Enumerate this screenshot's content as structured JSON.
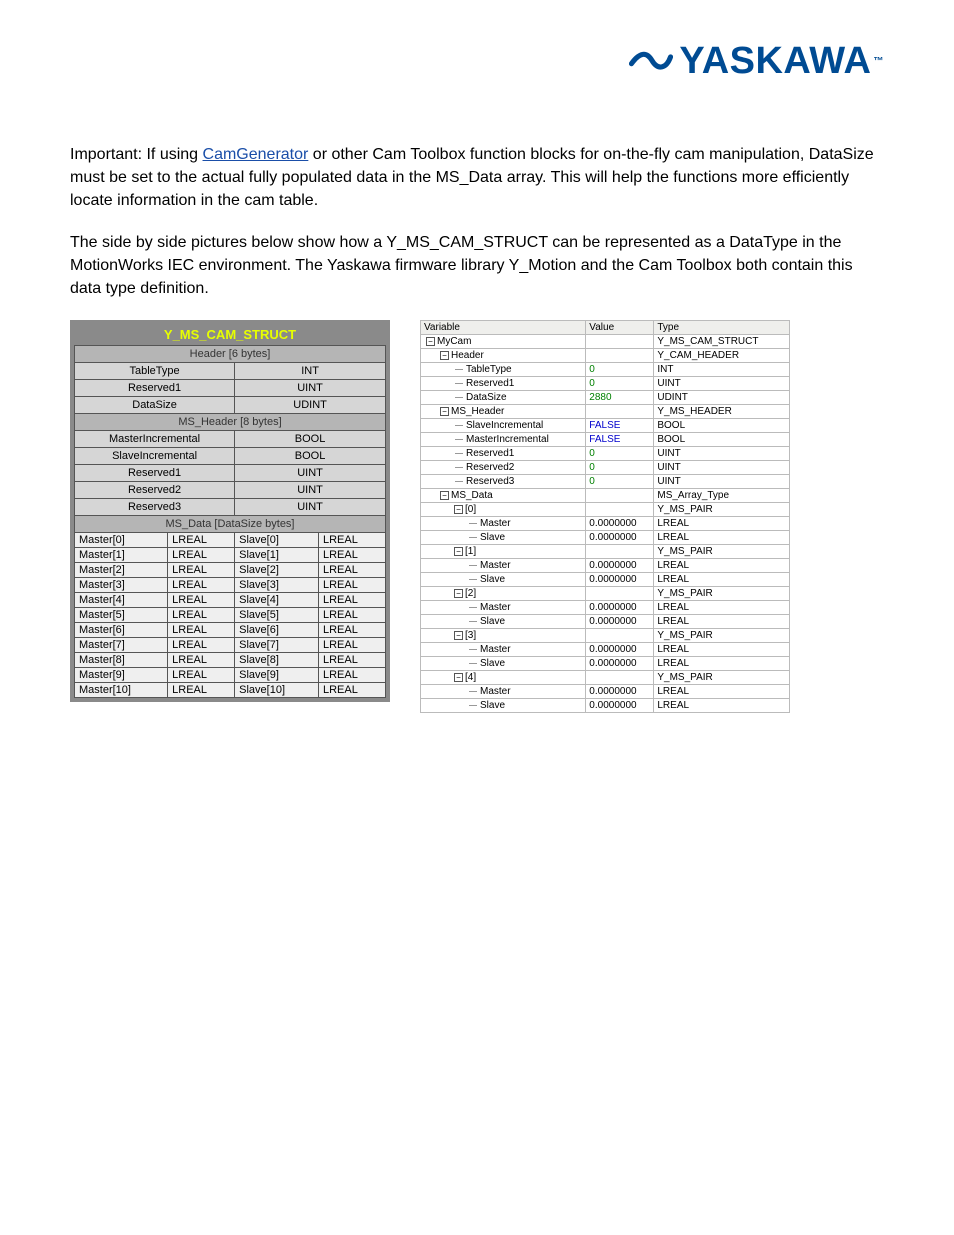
{
  "logo": {
    "text": "YASKAWA",
    "tm": "™"
  },
  "paragraphs": {
    "p1_a": "Important: If using ",
    "p1_link": "CamGenerator",
    "p1_b": " or other Cam Toolbox function blocks for on-the-fly cam manipulation, DataSize must be set to the actual fully populated data in the MS_Data array. This will help the functions more efficiently locate information in the cam table.",
    "p2": "The side by side pictures below show how a Y_MS_CAM_STRUCT can be represented as a DataType in the MotionWorks IEC environment. The Yaskawa firmware library Y_Motion and the Cam Toolbox both contain this data type definition."
  },
  "struct": {
    "title": "Y_MS_CAM_STRUCT",
    "header_label": "Header [6 bytes]",
    "header_rows": [
      {
        "n": "TableType",
        "t": "INT"
      },
      {
        "n": "Reserved1",
        "t": "UINT"
      },
      {
        "n": "DataSize",
        "t": "UDINT"
      }
    ],
    "msheader_label": "MS_Header [8 bytes]",
    "msheader_rows": [
      {
        "n": "MasterIncremental",
        "t": "BOOL"
      },
      {
        "n": "SlaveIncremental",
        "t": "BOOL"
      },
      {
        "n": "Reserved1",
        "t": "UINT"
      },
      {
        "n": "Reserved2",
        "t": "UINT"
      },
      {
        "n": "Reserved3",
        "t": "UINT"
      }
    ],
    "msdata_label": "MS_Data [DataSize bytes]",
    "msdata_rows": [
      {
        "m": "Master[0]",
        "mt": "LREAL",
        "s": "Slave[0]",
        "st": "LREAL"
      },
      {
        "m": "Master[1]",
        "mt": "LREAL",
        "s": "Slave[1]",
        "st": "LREAL"
      },
      {
        "m": "Master[2]",
        "mt": "LREAL",
        "s": "Slave[2]",
        "st": "LREAL"
      },
      {
        "m": "Master[3]",
        "mt": "LREAL",
        "s": "Slave[3]",
        "st": "LREAL"
      },
      {
        "m": "Master[4]",
        "mt": "LREAL",
        "s": "Slave[4]",
        "st": "LREAL"
      },
      {
        "m": "Master[5]",
        "mt": "LREAL",
        "s": "Slave[5]",
        "st": "LREAL"
      },
      {
        "m": "Master[6]",
        "mt": "LREAL",
        "s": "Slave[6]",
        "st": "LREAL"
      },
      {
        "m": "Master[7]",
        "mt": "LREAL",
        "s": "Slave[7]",
        "st": "LREAL"
      },
      {
        "m": "Master[8]",
        "mt": "LREAL",
        "s": "Slave[8]",
        "st": "LREAL"
      },
      {
        "m": "Master[9]",
        "mt": "LREAL",
        "s": "Slave[9]",
        "st": "LREAL"
      },
      {
        "m": "Master[10]",
        "mt": "LREAL",
        "s": "Slave[10]",
        "st": "LREAL"
      }
    ]
  },
  "watch": {
    "headers": [
      "Variable",
      "Value",
      "Type"
    ],
    "rows": [
      {
        "indent": 0,
        "box": "−",
        "name": "MyCam",
        "value": "",
        "type": "Y_MS_CAM_STRUCT"
      },
      {
        "indent": 1,
        "box": "−",
        "name": "Header",
        "value": "",
        "type": "Y_CAM_HEADER"
      },
      {
        "indent": 2,
        "box": "",
        "name": "TableType",
        "value": "0",
        "vclass": "val-green",
        "type": "INT"
      },
      {
        "indent": 2,
        "box": "",
        "name": "Reserved1",
        "value": "0",
        "vclass": "val-green",
        "type": "UINT"
      },
      {
        "indent": 2,
        "box": "",
        "name": "DataSize",
        "value": "2880",
        "vclass": "val-green",
        "type": "UDINT"
      },
      {
        "indent": 1,
        "box": "−",
        "name": "MS_Header",
        "value": "",
        "type": "Y_MS_HEADER"
      },
      {
        "indent": 2,
        "box": "",
        "name": "SlaveIncremental",
        "value": "FALSE",
        "vclass": "val-blue",
        "type": "BOOL"
      },
      {
        "indent": 2,
        "box": "",
        "name": "MasterIncremental",
        "value": "FALSE",
        "vclass": "val-blue",
        "type": "BOOL"
      },
      {
        "indent": 2,
        "box": "",
        "name": "Reserved1",
        "value": "0",
        "vclass": "val-green",
        "type": "UINT"
      },
      {
        "indent": 2,
        "box": "",
        "name": "Reserved2",
        "value": "0",
        "vclass": "val-green",
        "type": "UINT"
      },
      {
        "indent": 2,
        "box": "",
        "name": "Reserved3",
        "value": "0",
        "vclass": "val-green",
        "type": "UINT"
      },
      {
        "indent": 1,
        "box": "−",
        "name": "MS_Data",
        "value": "",
        "type": "MS_Array_Type"
      },
      {
        "indent": 2,
        "box": "−",
        "name": "[0]",
        "value": "",
        "type": "Y_MS_PAIR"
      },
      {
        "indent": 3,
        "box": "",
        "name": "Master",
        "value": "0.0000000",
        "vclass": "",
        "type": "LREAL"
      },
      {
        "indent": 3,
        "box": "",
        "name": "Slave",
        "value": "0.0000000",
        "vclass": "",
        "type": "LREAL"
      },
      {
        "indent": 2,
        "box": "−",
        "name": "[1]",
        "value": "",
        "type": "Y_MS_PAIR"
      },
      {
        "indent": 3,
        "box": "",
        "name": "Master",
        "value": "0.0000000",
        "vclass": "",
        "type": "LREAL"
      },
      {
        "indent": 3,
        "box": "",
        "name": "Slave",
        "value": "0.0000000",
        "vclass": "",
        "type": "LREAL"
      },
      {
        "indent": 2,
        "box": "−",
        "name": "[2]",
        "value": "",
        "type": "Y_MS_PAIR"
      },
      {
        "indent": 3,
        "box": "",
        "name": "Master",
        "value": "0.0000000",
        "vclass": "",
        "type": "LREAL"
      },
      {
        "indent": 3,
        "box": "",
        "name": "Slave",
        "value": "0.0000000",
        "vclass": "",
        "type": "LREAL"
      },
      {
        "indent": 2,
        "box": "−",
        "name": "[3]",
        "value": "",
        "type": "Y_MS_PAIR"
      },
      {
        "indent": 3,
        "box": "",
        "name": "Master",
        "value": "0.0000000",
        "vclass": "",
        "type": "LREAL"
      },
      {
        "indent": 3,
        "box": "",
        "name": "Slave",
        "value": "0.0000000",
        "vclass": "",
        "type": "LREAL"
      },
      {
        "indent": 2,
        "box": "−",
        "name": "[4]",
        "value": "",
        "type": "Y_MS_PAIR"
      },
      {
        "indent": 3,
        "box": "",
        "name": "Master",
        "value": "0.0000000",
        "vclass": "",
        "type": "LREAL"
      },
      {
        "indent": 3,
        "box": "",
        "name": "Slave",
        "value": "0.0000000",
        "vclass": "",
        "type": "LREAL"
      }
    ]
  }
}
